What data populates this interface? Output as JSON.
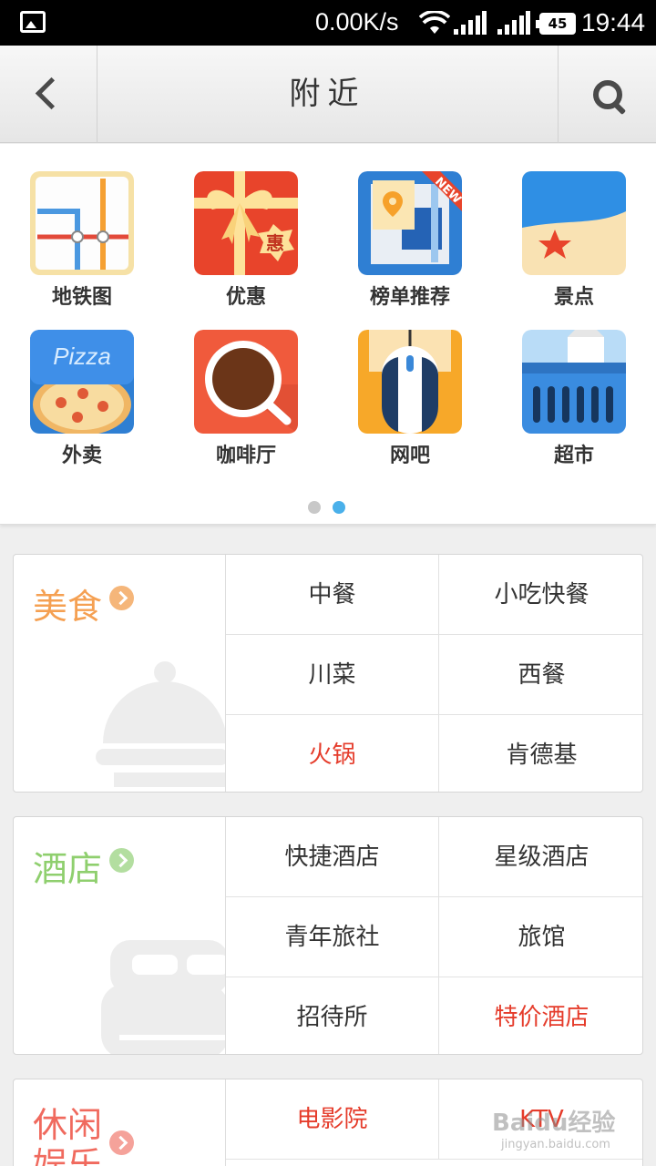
{
  "status_bar": {
    "speed": "0.00K/s",
    "battery": "45",
    "time": "19:44"
  },
  "title_bar": {
    "title": "附近"
  },
  "grid": {
    "items": [
      {
        "label": "地铁图",
        "icon": "subway-map-icon"
      },
      {
        "label": "优惠",
        "icon": "gift-discount-icon",
        "badge": "惠"
      },
      {
        "label": "榜单推荐",
        "icon": "ranking-map-icon",
        "ribbon": "NEW"
      },
      {
        "label": "景点",
        "icon": "beach-starfish-icon"
      },
      {
        "label": "外卖",
        "icon": "pizza-icon",
        "icon_text": "Pizza"
      },
      {
        "label": "咖啡厅",
        "icon": "coffee-cup-icon"
      },
      {
        "label": "网吧",
        "icon": "mouse-icon"
      },
      {
        "label": "超市",
        "icon": "shopping-basket-icon"
      }
    ],
    "page_count": 2,
    "active_page": 2
  },
  "categories": [
    {
      "name": "美食",
      "color": "#f5a052",
      "arrow_color": "#f5b67a",
      "items": [
        {
          "label": "中餐"
        },
        {
          "label": "小吃快餐"
        },
        {
          "label": "川菜"
        },
        {
          "label": "西餐"
        },
        {
          "label": "火锅",
          "hot": true
        },
        {
          "label": "肯德基"
        }
      ]
    },
    {
      "name": "酒店",
      "color": "#8fcf6e",
      "arrow_color": "#b3dea0",
      "items": [
        {
          "label": "快捷酒店"
        },
        {
          "label": "星级酒店"
        },
        {
          "label": "青年旅社"
        },
        {
          "label": "旅馆"
        },
        {
          "label": "招待所"
        },
        {
          "label": "特价酒店",
          "hot": true
        }
      ]
    },
    {
      "name": "休闲娱乐",
      "color": "#f06a5e",
      "arrow_color": "#f5a29a",
      "items": [
        {
          "label": "电影院",
          "hot": true
        },
        {
          "label": "KTV",
          "hot": true
        }
      ]
    }
  ],
  "watermark": {
    "brand": "Baidu经验",
    "url": "jingyan.baidu.com"
  }
}
